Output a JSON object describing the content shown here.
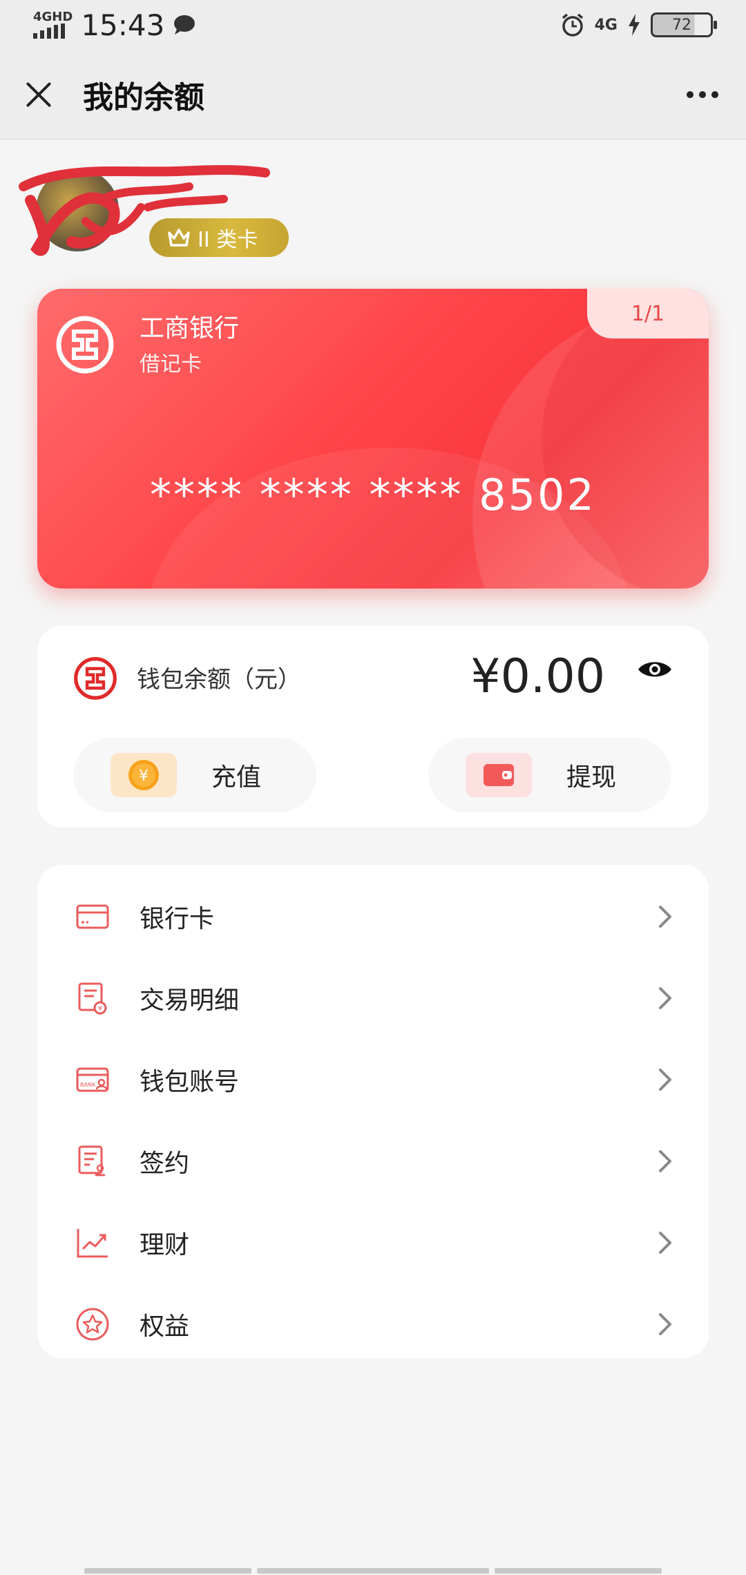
{
  "status_bar": {
    "network": "4GHD",
    "time": "15:43",
    "network_right": "4G",
    "battery": "72"
  },
  "header": {
    "title": "我的余额"
  },
  "profile": {
    "badge": "II 类卡"
  },
  "card": {
    "bank": "工商银行",
    "type": "借记卡",
    "number": "**** **** **** 8502",
    "page": "1/1"
  },
  "wallet": {
    "label": "钱包余额（元）",
    "amount": "¥0.00",
    "recharge": "充值",
    "withdraw": "提现"
  },
  "menu": {
    "items": [
      {
        "label": "银行卡",
        "icon": "bank-card-icon"
      },
      {
        "label": "交易明细",
        "icon": "transaction-detail-icon"
      },
      {
        "label": "钱包账号",
        "icon": "wallet-account-icon"
      },
      {
        "label": "签约",
        "icon": "contract-icon"
      },
      {
        "label": "理财",
        "icon": "finance-chart-icon"
      },
      {
        "label": "权益",
        "icon": "star-badge-icon"
      }
    ]
  },
  "colors": {
    "accent": "#e94a4a",
    "card_red": "#ff4549",
    "badge_gold": "#d2b03a",
    "background": "#f5f5f5"
  }
}
